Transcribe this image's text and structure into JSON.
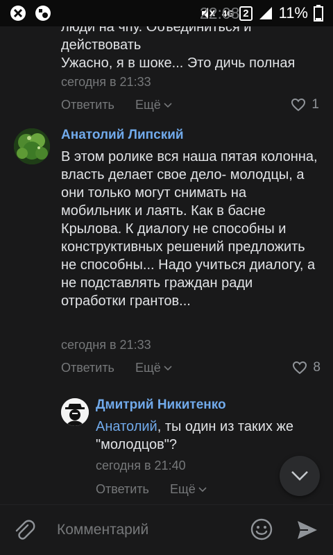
{
  "status_bar": {
    "network": "4G",
    "sim": "2",
    "battery": "11%",
    "time": "22:08"
  },
  "comments": [
    {
      "text_lines": [
        "люди на чпу. Объединиться и",
        "действовать",
        "Ужасно, я в шоке... Это дичь полная"
      ],
      "time": "сегодня в 21:33",
      "reply_label": "Ответить",
      "more_label": "Ещё",
      "likes": "1"
    },
    {
      "author": "Анатолий Липский",
      "text": "В этом ролике вся наша пятая колонна, власть делает свое дело- молодцы, а они только могут снимать на мобильник и лаять. Как в басне Крылова. К диалогу не способны и конструктивных решений предложить не способны... Надо учиться диалогу, а не подставлять граждан ради отработки грантов...",
      "time": "сегодня в 21:33",
      "reply_label": "Ответить",
      "more_label": "Ещё",
      "likes": "8"
    },
    {
      "author": "Дмитрий Никитенко",
      "mention": "Анатолий",
      "text_rest": ", ты один из таких же \"молодцов\"?",
      "time": "сегодня в 21:40",
      "reply_label": "Ответить",
      "more_label": "Ещё"
    }
  ],
  "composer": {
    "placeholder": "Комментарий"
  },
  "colors": {
    "background": "#19191a",
    "accent": "#71aaeb",
    "secondary_text": "#76787a"
  }
}
